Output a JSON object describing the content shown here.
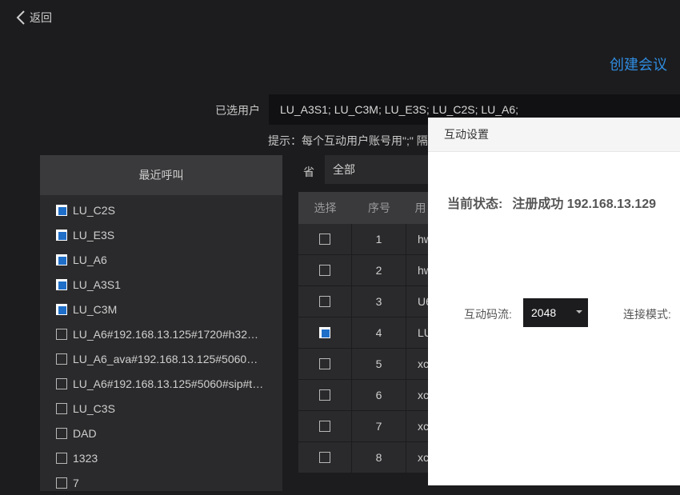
{
  "header": {
    "back_label": "返回",
    "create_label": "创建会议"
  },
  "selected": {
    "label": "已选用户",
    "value": "LU_A3S1;  LU_C3M;  LU_E3S;  LU_C2S;  LU_A6;",
    "hint": "提示：每个互动用户账号用\";\" 隔"
  },
  "recent": {
    "title": "最近呼叫",
    "items": [
      {
        "label": "LU_C2S",
        "checked": true
      },
      {
        "label": "LU_E3S",
        "checked": true
      },
      {
        "label": "LU_A6",
        "checked": true
      },
      {
        "label": "LU_A3S1",
        "checked": true
      },
      {
        "label": "LU_C3M",
        "checked": true
      },
      {
        "label": "LU_A6#192.168.13.125#1720#h32…",
        "checked": false
      },
      {
        "label": "LU_A6_ava#192.168.13.125#5060…",
        "checked": false
      },
      {
        "label": "LU_A6#192.168.13.125#5060#sip#t…",
        "checked": false
      },
      {
        "label": "LU_C3S",
        "checked": false
      },
      {
        "label": "DAD",
        "checked": false
      },
      {
        "label": "1323",
        "checked": false
      },
      {
        "label": "7",
        "checked": false
      }
    ]
  },
  "filter": {
    "province_label": "省",
    "province_value": "全部"
  },
  "table": {
    "headers": [
      "选择",
      "序号",
      "用"
    ],
    "rows": [
      {
        "no": "1",
        "user": "hw",
        "checked": false
      },
      {
        "no": "2",
        "user": "hw",
        "checked": false
      },
      {
        "no": "3",
        "user": "U6",
        "checked": false
      },
      {
        "no": "4",
        "user": "LU",
        "checked": true
      },
      {
        "no": "5",
        "user": "xc",
        "checked": false
      },
      {
        "no": "6",
        "user": "xc",
        "checked": false
      },
      {
        "no": "7",
        "user": "xc",
        "checked": false
      },
      {
        "no": "8",
        "user": "xc",
        "checked": false
      }
    ]
  },
  "modal": {
    "title": "互动设置",
    "status_label": "当前状态:",
    "status_value": "注册成功 192.168.13.129",
    "rate_label": "互动码流:",
    "rate_value": "2048",
    "mode_label": "连接模式:"
  },
  "colors": {
    "accent": "#2f8ce0",
    "checkbox_fill": "#1f6fc9",
    "background": "#1c1c1e",
    "panel": "#2a2a2c"
  }
}
